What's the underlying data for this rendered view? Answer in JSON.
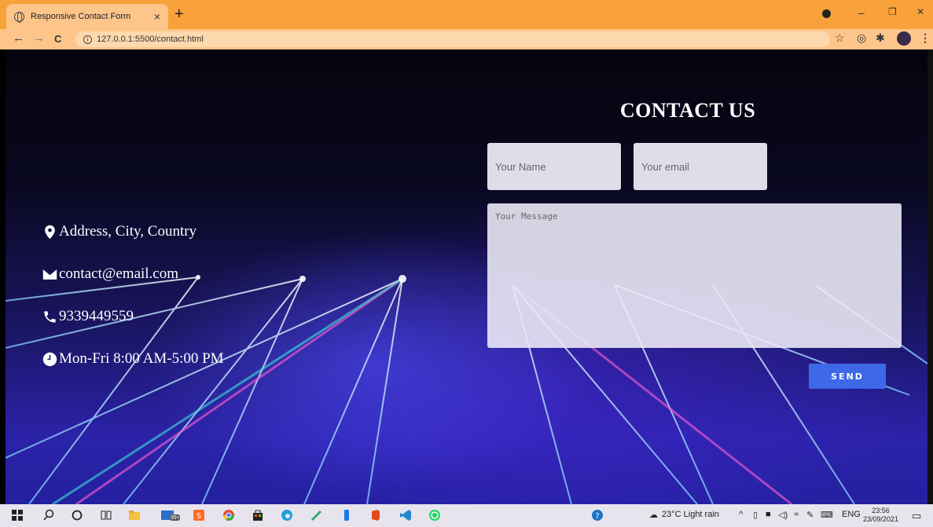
{
  "browser": {
    "tab_title": "Responsive Contact Form",
    "tab_close": "×",
    "new_tab": "+",
    "url": "127.0.0.1:5500/contact.html",
    "minimize": "–",
    "maximize": "❐",
    "close": "✕",
    "back": "←",
    "forward": "→",
    "reload": "C",
    "star": "☆",
    "menu": "⋮"
  },
  "contact_info": {
    "address": "Address, City, Country",
    "email": "contact@email.com",
    "phone": "9339449559",
    "hours": "Mon-Fri 8:00 AM-5:00 PM"
  },
  "form": {
    "title": "CONTACT US",
    "name_placeholder": "Your Name",
    "email_placeholder": "Your email",
    "message_placeholder": "Your Message",
    "send_label": "SEND"
  },
  "taskbar": {
    "badge": "99+",
    "weather": "23°C  Light rain",
    "lang": "ENG",
    "time": "23:56",
    "date": "23/09/2021"
  },
  "colors": {
    "tabbar": "#f9a13a",
    "send_button": "#3d68e8",
    "taskbar": "#e8e4ee"
  }
}
